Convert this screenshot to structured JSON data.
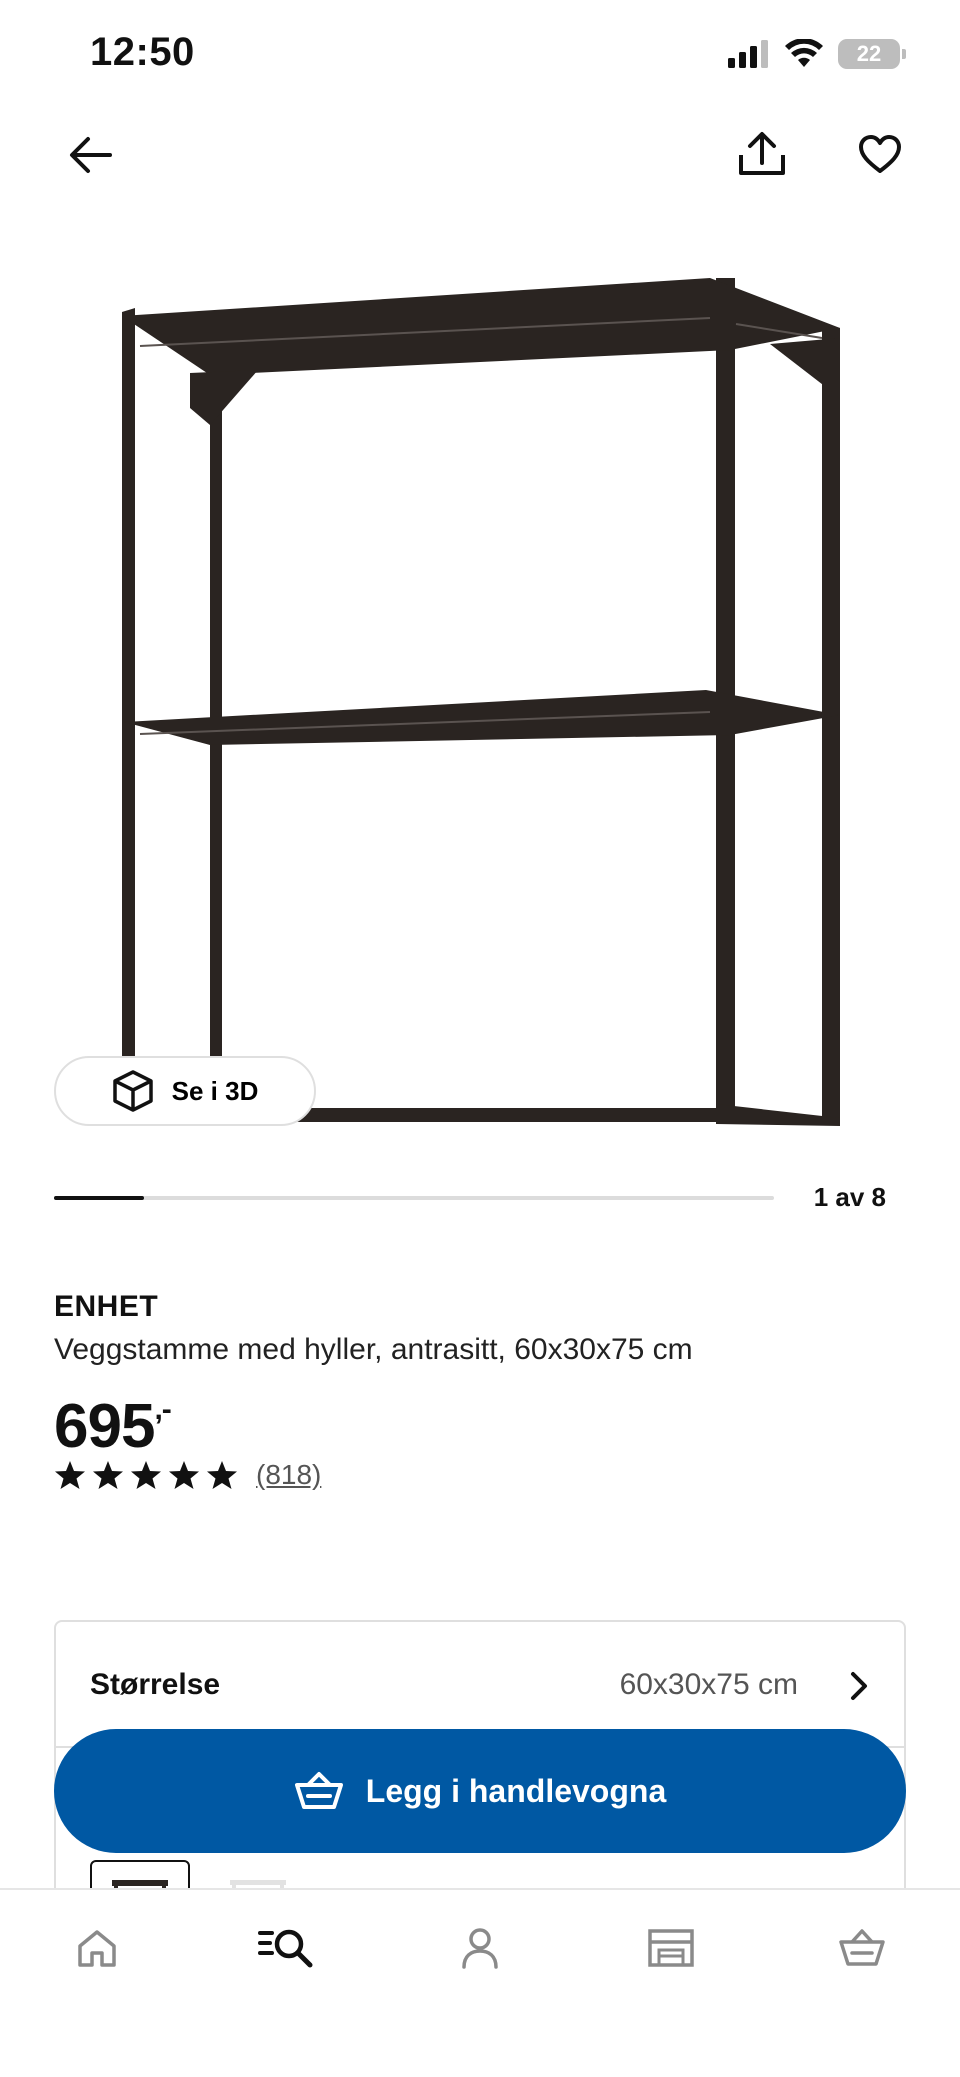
{
  "status_bar": {
    "time": "12:50",
    "battery_level": "22",
    "icons": [
      "signal-icon",
      "wifi-icon",
      "battery-icon"
    ]
  },
  "header": {
    "back_icon": "arrow-left-icon",
    "share_icon": "share-icon",
    "favorite_icon": "heart-icon"
  },
  "gallery": {
    "view_3d_label": "Se i 3D",
    "view_3d_icon": "cube-icon",
    "counter": "1 av 8",
    "current_image": 1,
    "total_images": 8
  },
  "product": {
    "name": "ENHET",
    "description": "Veggstamme med hyller, antrasitt, 60x30x75 cm",
    "price": "695",
    "price_suffix": ",-",
    "rating_stars": 5,
    "review_count": "(818)"
  },
  "size_selector": {
    "label": "Størrelse",
    "value": "60x30x75 cm",
    "chevron_icon": "chevron-right-icon"
  },
  "cta": {
    "add_to_cart_label": "Legg i handlevogna",
    "icon": "basket-icon"
  },
  "bottom_nav": [
    {
      "name": "home",
      "icon": "home-icon"
    },
    {
      "name": "search",
      "icon": "search-list-icon",
      "active": true
    },
    {
      "name": "profile",
      "icon": "user-icon"
    },
    {
      "name": "store",
      "icon": "store-icon"
    },
    {
      "name": "cart",
      "icon": "basket-icon"
    }
  ],
  "colors": {
    "primary_blue": "#0058a3",
    "frame_dark": "#2a2421",
    "text": "#111111",
    "muted_text": "#555555",
    "icon_gray": "#8a8a8a"
  }
}
